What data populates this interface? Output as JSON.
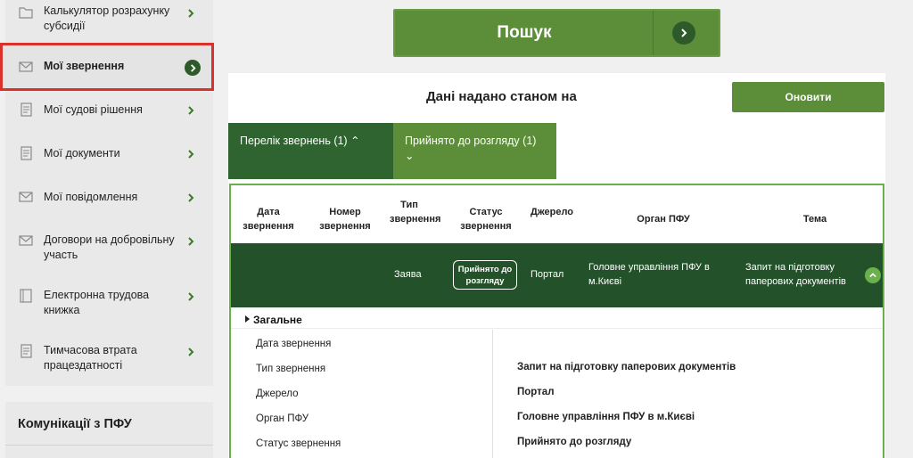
{
  "sidebar": {
    "items": [
      {
        "label": "Калькулятор розрахунку субсидії",
        "icon": "folder-icon"
      },
      {
        "label": "Мої звернення",
        "icon": "envelope-icon"
      },
      {
        "label": "Мої судові рішення",
        "icon": "document-icon"
      },
      {
        "label": "Мої документи",
        "icon": "document-icon"
      },
      {
        "label": "Мої повідомлення",
        "icon": "envelope-icon"
      },
      {
        "label": "Договори на добровільну участь",
        "icon": "envelope-icon"
      },
      {
        "label": "Електронна трудова книжка",
        "icon": "book-icon"
      },
      {
        "label": "Тимчасова втрата працездатності",
        "icon": "document-icon"
      }
    ],
    "communications_title": "Комунікації з ПФУ"
  },
  "search": {
    "label": "Пошук"
  },
  "data_header": {
    "title": "Дані надано станом на",
    "refresh_label": "Оновити"
  },
  "tabs": [
    {
      "label": "Перелік звернень (1) ⌃"
    },
    {
      "label": "Прийнято до розгляду (1) ⌄"
    }
  ],
  "table": {
    "columns": [
      "Дата звернення",
      "Номер звернення",
      "Тип звернення",
      "Статус звернення",
      "Джерело",
      "Орган ПФУ",
      "Тема"
    ],
    "row": {
      "date": "",
      "number": "",
      "type": "Заява",
      "status": "Прийнято до розгляду",
      "source": "Портал",
      "organ": "Головне управління ПФУ в м.Києві",
      "topic": "Запит на підготовку паперових документів"
    }
  },
  "details": {
    "section_title": "Загальне",
    "labels": [
      "Дата звернення",
      "Тип звернення",
      "Джерело",
      "Орган ПФУ",
      "Статус звернення"
    ],
    "values": [
      "Запит на підготовку паперових документів",
      "Портал",
      "Головне управління ПФУ в м.Києві",
      "Прийнято до розгляду"
    ]
  },
  "colors": {
    "primary_green": "#5c8e3a",
    "dark_green": "#23512a",
    "highlight_border": "#d9312b",
    "table_border": "#6ab04c"
  }
}
